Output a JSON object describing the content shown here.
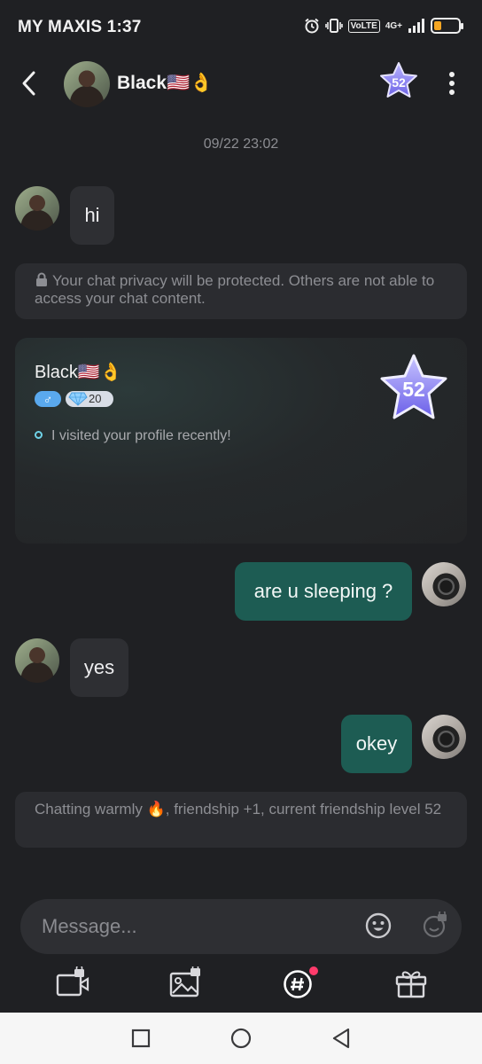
{
  "status_bar": {
    "carrier_time": "MY MAXIS 1:37",
    "volte": "VoLTE",
    "network": "4G+",
    "battery_color": "#f5a623"
  },
  "header": {
    "back_icon": "chevron-left-icon",
    "contact_name": "Black🇺🇸👌",
    "level": "52",
    "more_icon": "more-vertical-icon"
  },
  "chat": {
    "timestamp": "09/22 23:02",
    "messages": [
      {
        "from": "contact",
        "text": "hi"
      },
      {
        "from": "me",
        "text": "are u sleeping ?"
      },
      {
        "from": "contact",
        "text": "yes"
      },
      {
        "from": "me",
        "text": "okey"
      }
    ],
    "privacy_notice": "Your chat privacy will be protected. Others are not able to access your chat content.",
    "friendship_notice": "Chatting warmly 🔥, friendship +1, current friendship level 52"
  },
  "profile_card": {
    "name": "Black🇺🇸👌",
    "gender_symbol": "♂",
    "gem_count": "20",
    "visit_text": "I visited your profile recently!",
    "level": "52"
  },
  "input": {
    "placeholder": "Message..."
  },
  "toolbar": {
    "items": [
      "video-lock-icon",
      "image-lock-icon",
      "hashtag-chat-icon",
      "gift-icon"
    ],
    "notification_dot_color": "#ff3b6b"
  },
  "colors": {
    "background": "#1f2023",
    "incoming_bubble": "#2e2f33",
    "outgoing_bubble": "#1d5c53",
    "accent_cyan": "#6fd3e8"
  }
}
